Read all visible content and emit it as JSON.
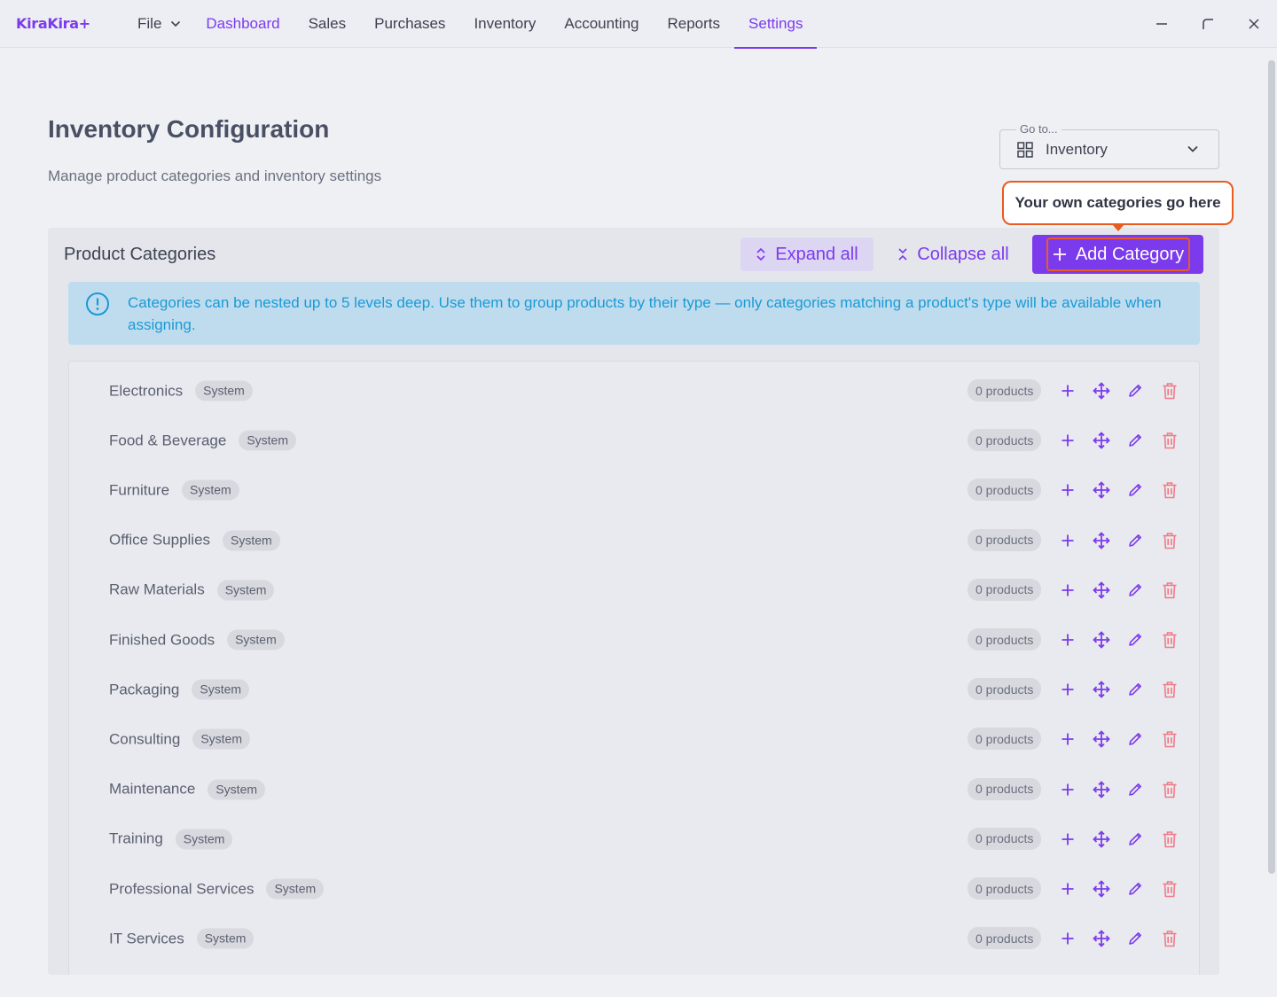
{
  "app": {
    "logo": "KiraKira+"
  },
  "menu": {
    "file": "File",
    "items": [
      "Dashboard",
      "Sales",
      "Purchases",
      "Inventory",
      "Accounting",
      "Reports",
      "Settings"
    ],
    "active": "Settings"
  },
  "header": {
    "title": "Inventory Configuration",
    "subtitle": "Manage product categories and inventory settings"
  },
  "goto": {
    "label": "Go to...",
    "value": "Inventory"
  },
  "tooltip": {
    "text": "Your own categories go here"
  },
  "panel": {
    "title": "Product Categories",
    "expand_label": "Expand all",
    "collapse_label": "Collapse all",
    "add_label": "Add Category",
    "alert": "Categories can be nested up to 5 levels deep. Use them to group products by their type — only categories matching a product's type will be available when assigning."
  },
  "categories": [
    {
      "name": "Electronics",
      "badge": "System",
      "count": "0 products"
    },
    {
      "name": "Food & Beverage",
      "badge": "System",
      "count": "0 products"
    },
    {
      "name": "Furniture",
      "badge": "System",
      "count": "0 products"
    },
    {
      "name": "Office Supplies",
      "badge": "System",
      "count": "0 products"
    },
    {
      "name": "Raw Materials",
      "badge": "System",
      "count": "0 products"
    },
    {
      "name": "Finished Goods",
      "badge": "System",
      "count": "0 products"
    },
    {
      "name": "Packaging",
      "badge": "System",
      "count": "0 products"
    },
    {
      "name": "Consulting",
      "badge": "System",
      "count": "0 products"
    },
    {
      "name": "Maintenance",
      "badge": "System",
      "count": "0 products"
    },
    {
      "name": "Training",
      "badge": "System",
      "count": "0 products"
    },
    {
      "name": "Professional Services",
      "badge": "System",
      "count": "0 products"
    },
    {
      "name": "IT Services",
      "badge": "System",
      "count": "0 products"
    }
  ],
  "colors": {
    "accent": "#7c3aed",
    "highlight": "#ea5b1f",
    "info": "#1a9ad6",
    "danger": "#f07a86"
  }
}
